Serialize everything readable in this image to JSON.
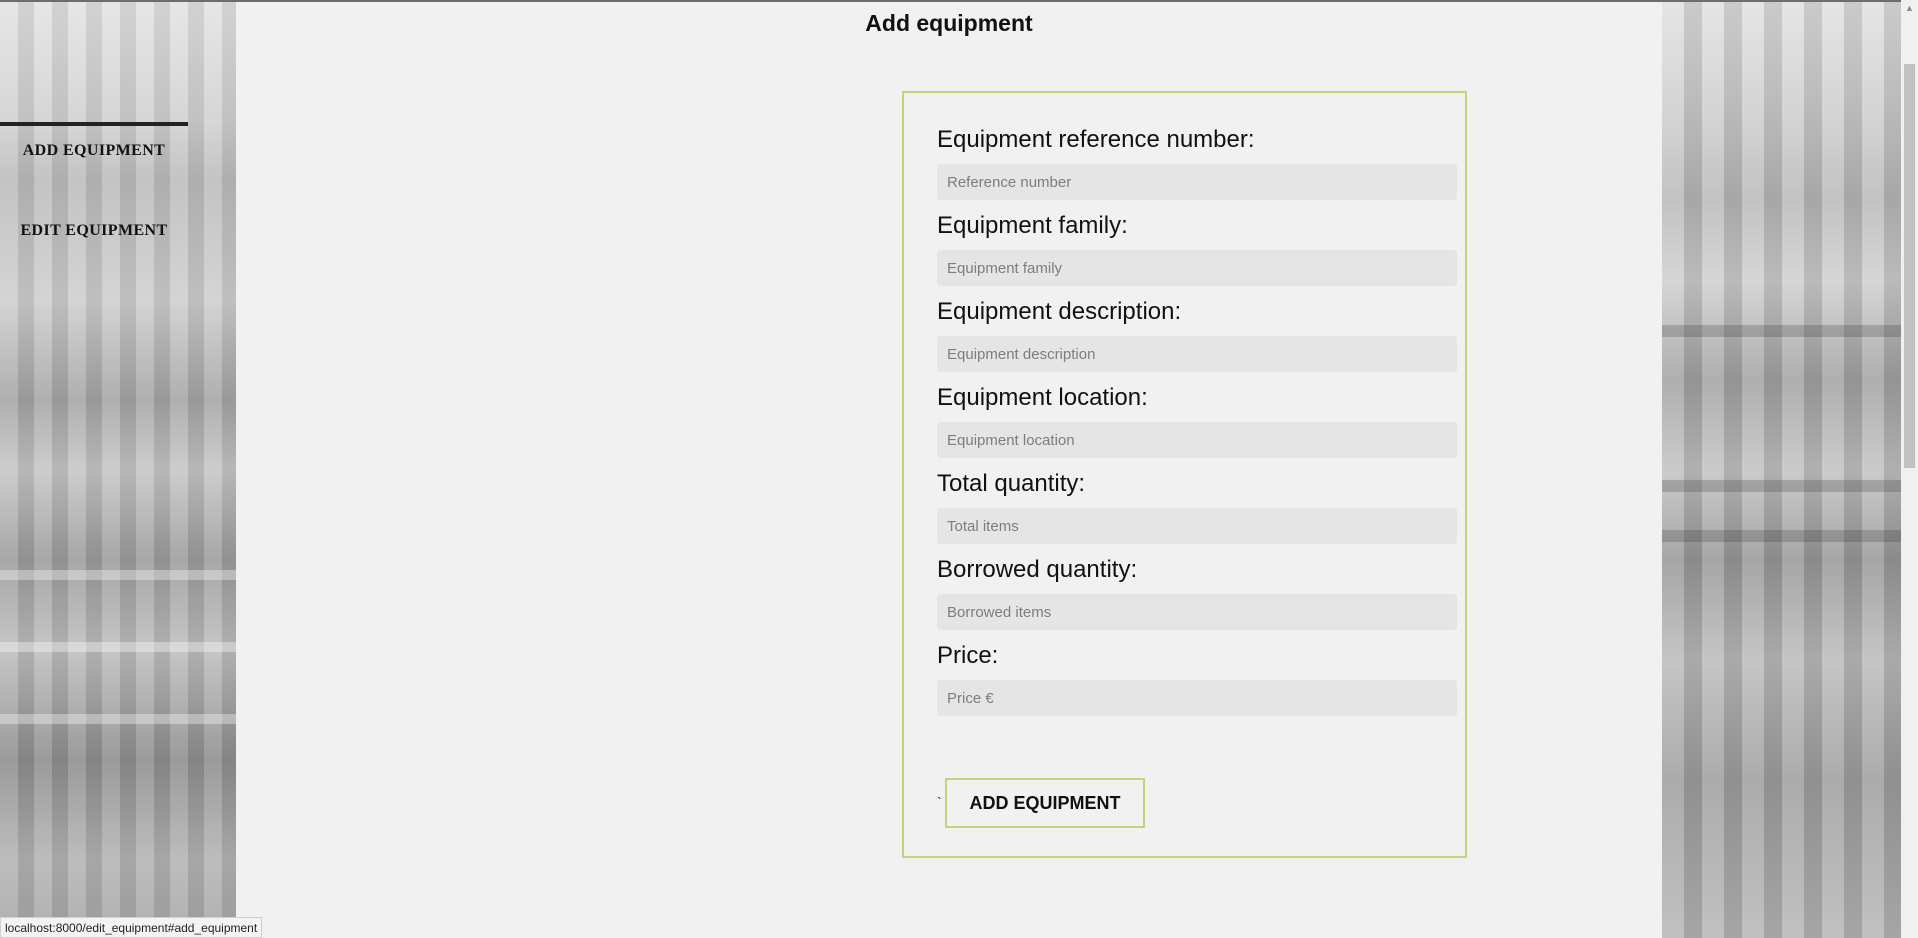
{
  "page_title": "Add equipment",
  "nav": {
    "items": [
      {
        "label": "ADD EQUIPMENT"
      },
      {
        "label": "EDIT EQUIPMENT"
      }
    ]
  },
  "form": {
    "fields": [
      {
        "label": "Equipment reference number:",
        "placeholder": "Reference number",
        "value": ""
      },
      {
        "label": "Equipment family:",
        "placeholder": "Equipment family",
        "value": ""
      },
      {
        "label": "Equipment description:",
        "placeholder": "Equipment description",
        "value": ""
      },
      {
        "label": "Equipment location:",
        "placeholder": "Equipment location",
        "value": ""
      },
      {
        "label": "Total quantity:",
        "placeholder": "Total items",
        "value": ""
      },
      {
        "label": "Borrowed quantity:",
        "placeholder": "Borrowed items",
        "value": ""
      },
      {
        "label": "Price:",
        "placeholder": "Price €",
        "value": ""
      }
    ],
    "stray_char": "`",
    "submit_label": "ADD EQUIPMENT"
  },
  "status_bar": {
    "url": "localhost:8000/edit_equipment#add_equipment"
  },
  "colors": {
    "accent_border": "#c3d37a",
    "panel_bg": "#f1f1f1",
    "input_bg": "#e5e5e5"
  }
}
